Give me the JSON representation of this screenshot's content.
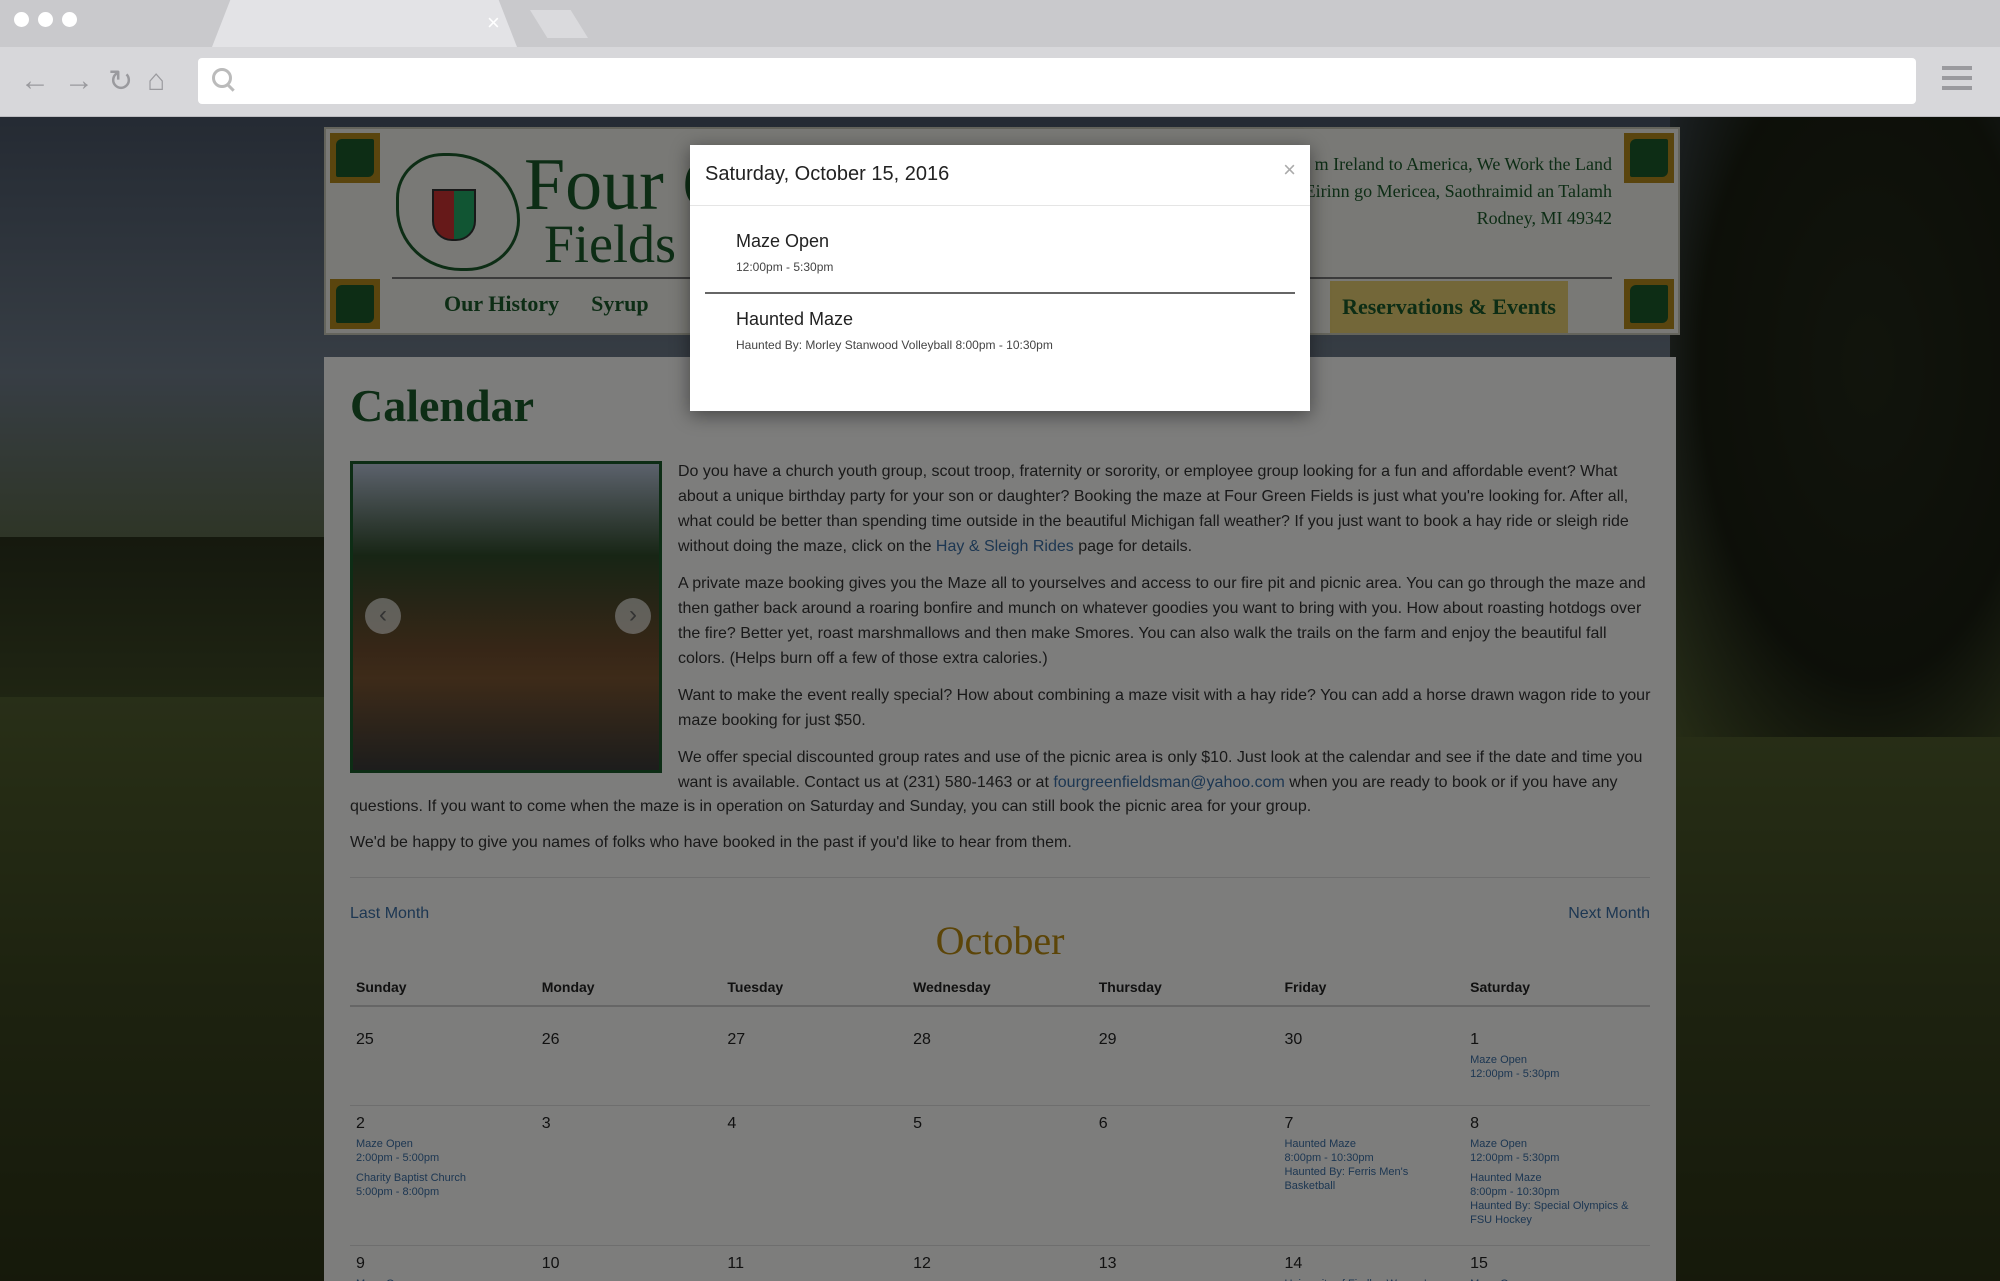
{
  "browser": {
    "url": "",
    "tab_close": "×"
  },
  "site": {
    "brand_line1": "Four G",
    "brand_line2": "Fields F",
    "tagline": [
      "m Ireland to America, We Work the Land",
      "Eirinn go Mericea, Saothraimid an Talamh",
      "Rodney, MI 49342"
    ],
    "nav": [
      "Our History",
      "Syrup"
    ],
    "nav_active": "Reservations & Events"
  },
  "page": {
    "title": "Calendar",
    "para1_pre": "Do you have a church youth group, scout troop, fraternity or sorority, or employee group looking for a fun and affordable event? What about a unique birthday party for your son or daughter? Booking the maze at Four Green Fields is just what you're looking for. After all, what could be better than spending time outside in the beautiful Michigan fall weather? If you just want to book a hay ride or sleigh ride without doing the maze, click on the ",
    "para1_link": "Hay & Sleigh Rides",
    "para1_post": " page for details.",
    "para2": "A private maze booking gives you the Maze all to yourselves and access to our fire pit and picnic area. You can go through the maze and then gather back around a roaring bonfire and munch on whatever goodies you want to bring with you. How about roasting hotdogs over the fire? Better yet, roast marshmallows and then make Smores. You can also walk the trails on the farm and enjoy the beautiful fall colors. (Helps burn off a few of those extra calories.)",
    "para3": "Want to make the event really special? How about combining a maze visit with a hay ride? You can add a horse drawn wagon ride to your maze booking for just $50.",
    "para4_pre": "We offer special discounted group rates and use of the picnic area is only $10. Just look at the calendar and see if the date and time you want is available. Contact us at (231) 580-1463 or at ",
    "para4_link": "fourgreenfieldsman@yahoo.com",
    "para4_mid": " when you are ready to book or if you have any",
    "para4_cont": "questions. If you want to come when the maze is in operation on Saturday and Sunday, you can still book the picnic area for your group.",
    "para5": "We'd be happy to give you names of folks who have booked in the past if you'd like to hear from them."
  },
  "calendar": {
    "prev": "Last Month",
    "next": "Next Month",
    "month": "October",
    "weekdays": [
      "Sunday",
      "Monday",
      "Tuesday",
      "Wednesday",
      "Thursday",
      "Friday",
      "Saturday"
    ],
    "weeks": [
      [
        {
          "day": "25",
          "events": []
        },
        {
          "day": "26",
          "events": []
        },
        {
          "day": "27",
          "events": []
        },
        {
          "day": "28",
          "events": []
        },
        {
          "day": "29",
          "events": []
        },
        {
          "day": "30",
          "events": []
        },
        {
          "day": "1",
          "events": [
            [
              "Maze Open",
              "12:00pm - 5:30pm"
            ]
          ]
        }
      ],
      [
        {
          "day": "2",
          "events": [
            [
              "Maze Open",
              "2:00pm - 5:00pm"
            ],
            [
              "Charity Baptist Church",
              "5:00pm - 8:00pm"
            ]
          ]
        },
        {
          "day": "3",
          "events": []
        },
        {
          "day": "4",
          "events": []
        },
        {
          "day": "5",
          "events": []
        },
        {
          "day": "6",
          "events": []
        },
        {
          "day": "7",
          "events": [
            [
              "Haunted Maze",
              "8:00pm - 10:30pm",
              "Haunted By: Ferris Men's Basketball"
            ]
          ]
        },
        {
          "day": "8",
          "events": [
            [
              "Maze Open",
              "12:00pm - 5:30pm"
            ],
            [
              "Haunted Maze",
              "8:00pm - 10:30pm",
              "Haunted By: Special Olympics & FSU Hockey"
            ]
          ]
        }
      ],
      [
        {
          "day": "9",
          "events": [
            [
              "Maze Open"
            ]
          ]
        },
        {
          "day": "10",
          "events": []
        },
        {
          "day": "11",
          "events": []
        },
        {
          "day": "12",
          "events": []
        },
        {
          "day": "13",
          "events": []
        },
        {
          "day": "14",
          "events": [
            [
              "University of Findlay Women's"
            ]
          ]
        },
        {
          "day": "15",
          "events": [
            [
              "Maze Open"
            ]
          ]
        }
      ]
    ]
  },
  "modal": {
    "title": "Saturday, October 15, 2016",
    "close": "×",
    "events": [
      {
        "name": "Maze Open",
        "meta": "12:00pm - 5:30pm"
      },
      {
        "name": "Haunted Maze",
        "meta": "Haunted By: Morley Stanwood Volleyball   8:00pm - 10:30pm"
      }
    ]
  }
}
